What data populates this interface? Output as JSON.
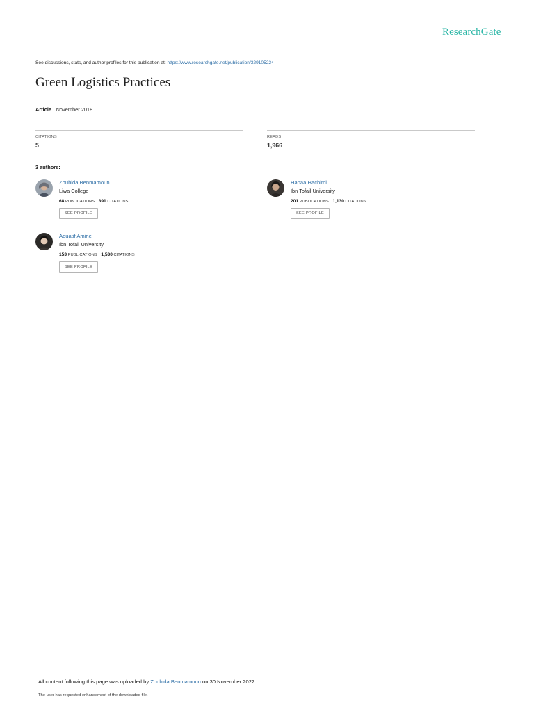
{
  "brand": {
    "name": "ResearchGate",
    "color": "#2ab6a6"
  },
  "intro": {
    "text": "See discussions, stats, and author profiles for this publication at:",
    "link": "https://www.researchgate.net/publication/329105224"
  },
  "title": "Green Logistics Practices",
  "meta": {
    "type": "Article",
    "separator": " · ",
    "date": "November 2018"
  },
  "stats": {
    "citations": {
      "label": "CITATIONS",
      "value": "5"
    },
    "reads": {
      "label": "READS",
      "value": "1,966"
    }
  },
  "authors_label": "3 authors:",
  "authors": [
    {
      "name": "Zoubida Benmamoun",
      "institution": "Liwa College",
      "publications": "68",
      "publications_label": "PUBLICATIONS",
      "citations": "391",
      "citations_label": "CITATIONS",
      "button": "SEE PROFILE"
    },
    {
      "name": "Hanaa Hachimi",
      "institution": "Ibn Tofail University",
      "publications": "201",
      "publications_label": "PUBLICATIONS",
      "citations": "1,130",
      "citations_label": "CITATIONS",
      "button": "SEE PROFILE"
    },
    {
      "name": "Aouatif Amine",
      "institution": "Ibn Tofail University",
      "publications": "153",
      "publications_label": "PUBLICATIONS",
      "citations": "1,530",
      "citations_label": "CITATIONS",
      "button": "SEE PROFILE"
    }
  ],
  "footer": {
    "prefix": "All content following this page was uploaded by",
    "uploader": "Zoubida Benmamoun",
    "suffix": "on 30 November 2022.",
    "note": "The user has requested enhancement of the downloaded file."
  },
  "colors": {
    "link": "#2d6ea6",
    "divider": "#c9c9c9"
  }
}
